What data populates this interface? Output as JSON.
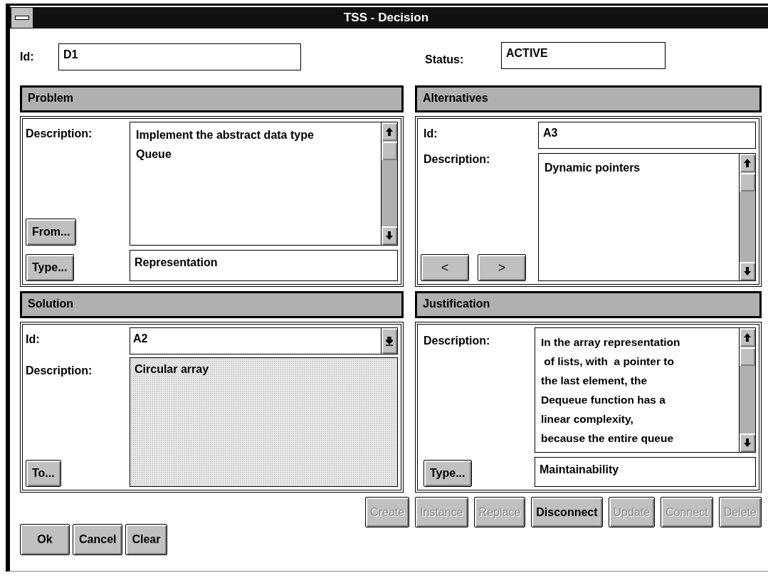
{
  "window": {
    "title": "TSS - Decision"
  },
  "header": {
    "id_label": "Id:",
    "id_value": "D1",
    "status_label": "Status:",
    "status_value": "ACTIVE"
  },
  "problem": {
    "title": "Problem",
    "description_label": "Description:",
    "description": "Implement the abstract data type Queue",
    "from_button": "From...",
    "type_button": "Type...",
    "type_value": "Representation"
  },
  "alternatives": {
    "title": "Alternatives",
    "id_label": "Id:",
    "id_value": "A3",
    "description_label": "Description:",
    "description": "Dynamic pointers",
    "prev_button": "<",
    "next_button": ">"
  },
  "solution": {
    "title": "Solution",
    "id_label": "Id:",
    "id_value": "A2",
    "description_label": "Description:",
    "description": "Circular array",
    "description_disabled": true,
    "to_button": "To..."
  },
  "justification": {
    "title": "Justification",
    "description_label": "Description:",
    "description": "In the array representation\n of lists, with  a pointer to\nthe last element, the\nDequeue function has a\nlinear complexity,\nbecause the entire queue",
    "type_button": "Type...",
    "type_value": "Maintainability"
  },
  "actions": [
    {
      "label": "Create",
      "disabled": true
    },
    {
      "label": "Instance",
      "disabled": true
    },
    {
      "label": "Replace",
      "disabled": true
    },
    {
      "label": "Disconnect",
      "disabled": false
    },
    {
      "label": "Update",
      "disabled": true
    },
    {
      "label": "Connect",
      "disabled": true
    },
    {
      "label": "Delete",
      "disabled": true
    }
  ],
  "dialog_buttons": [
    "Ok",
    "Cancel",
    "Clear"
  ]
}
